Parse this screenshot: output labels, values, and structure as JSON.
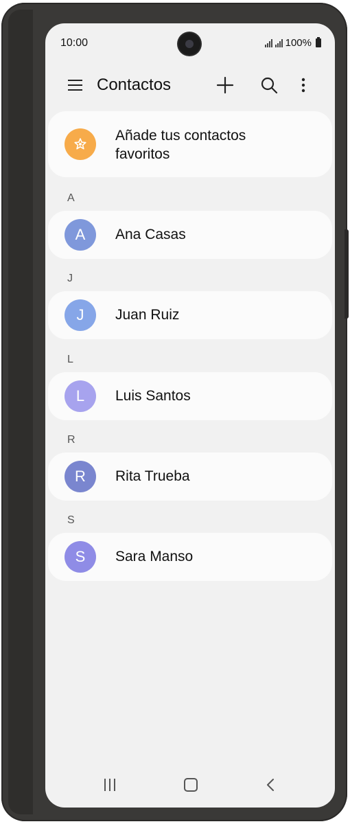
{
  "status_bar": {
    "time": "10:00",
    "battery": "100%"
  },
  "app_bar": {
    "title": "Contactos"
  },
  "favorites": {
    "label": "Añade tus contactos favoritos",
    "color": "#f7ab4a"
  },
  "sections": [
    {
      "letter": "A",
      "contact": {
        "name": "Ana Casas",
        "initial": "A",
        "color": "#7f98db"
      }
    },
    {
      "letter": "J",
      "contact": {
        "name": "Juan Ruiz",
        "initial": "J",
        "color": "#86a6e8"
      }
    },
    {
      "letter": "L",
      "contact": {
        "name": "Luis Santos",
        "initial": "L",
        "color": "#a7a3ee"
      }
    },
    {
      "letter": "R",
      "contact": {
        "name": "Rita Trueba",
        "initial": "R",
        "color": "#7a86cf"
      }
    },
    {
      "letter": "S",
      "contact": {
        "name": "Sara Manso",
        "initial": "S",
        "color": "#8f8ce6"
      }
    }
  ],
  "icons": {
    "menu": "menu-icon",
    "add": "add-icon",
    "search": "search-icon",
    "more": "more-vertical-icon",
    "favorite": "star-icon",
    "recents": "recents-icon",
    "home": "home-icon",
    "back": "back-icon"
  }
}
